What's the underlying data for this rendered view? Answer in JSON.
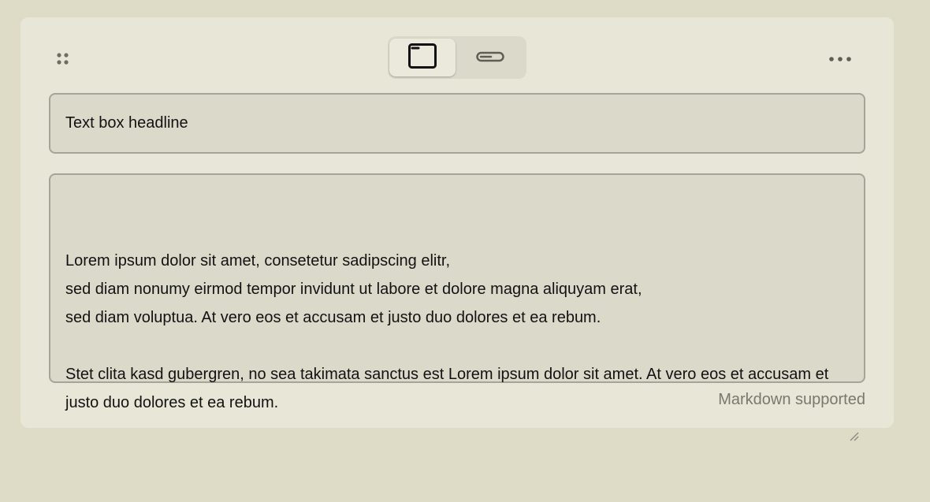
{
  "editor": {
    "headline_value": "Text box headline",
    "body_value": "Lorem ipsum dolor sit amet, consetetur sadipscing elitr,\nsed diam nonumy eirmod tempor invidunt ut labore et dolore magna aliquyam erat,\nsed diam voluptua. At vero eos et accusam et justo duo dolores et ea rebum.\n\nStet clita kasd gubergren, no sea takimata sanctus est Lorem ipsum dolor sit amet. At vero eos et accusam et justo duo dolores et ea rebum.",
    "hint": "Markdown supported"
  },
  "toolbar": {
    "layout_options": [
      {
        "icon": "window-icon",
        "selected": true
      },
      {
        "icon": "inline-bar-icon",
        "selected": false
      }
    ],
    "drag_icon": "drag-handle-icon",
    "more_icon": "more-horizontal-icon"
  },
  "colors": {
    "background": "#dedcc7",
    "card": "#e8e6d7",
    "field": "#dbd9ca",
    "field_border": "#a6a498",
    "text": "#121212",
    "hint": "#7a786d"
  }
}
